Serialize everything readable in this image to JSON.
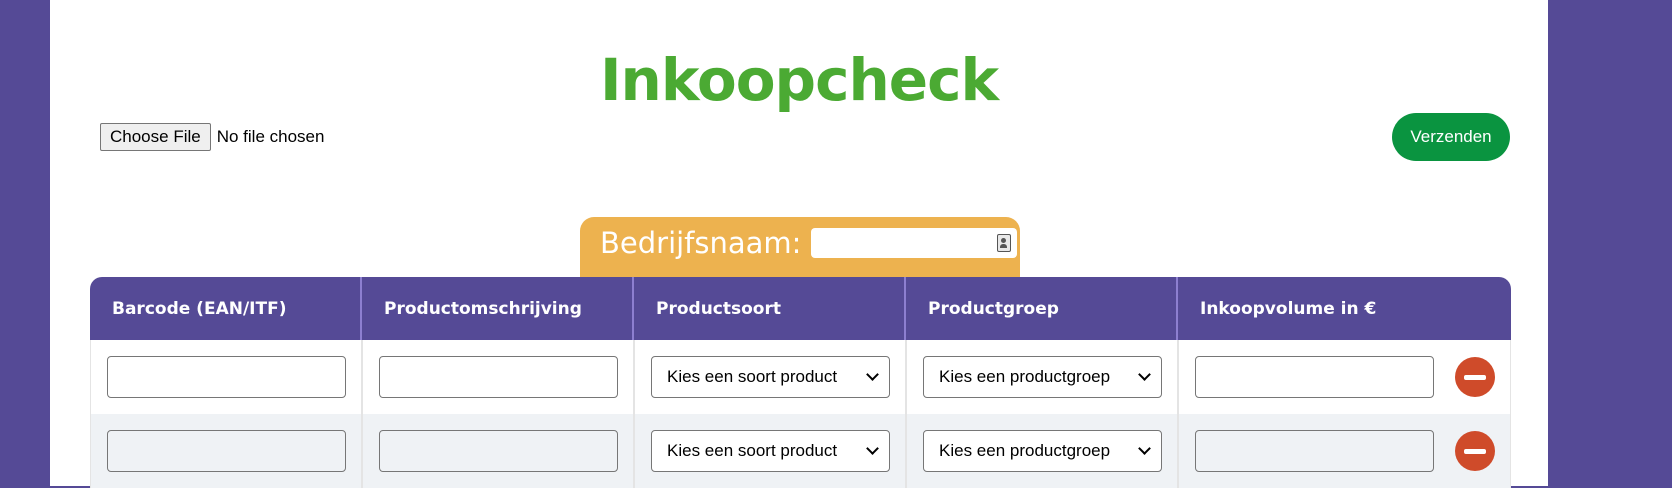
{
  "title": "Inkoopcheck",
  "file_upload": {
    "button_label": "Choose File",
    "status": "No file chosen"
  },
  "submit_label": "Verzenden",
  "company": {
    "label": "Bedrijfsnaam:",
    "value": ""
  },
  "table": {
    "headers": [
      "Barcode (EAN/ITF)",
      "Productomschrijving",
      "Productsoort",
      "Productgroep",
      "Inkoopvolume in €"
    ],
    "rows": [
      {
        "barcode": "",
        "description": "",
        "product_type": "Kies een soort product",
        "product_group": "Kies een productgroep",
        "volume": ""
      },
      {
        "barcode": "",
        "description": "",
        "product_type": "Kies een soort product",
        "product_group": "Kies een productgroep",
        "volume": ""
      }
    ]
  },
  "colors": {
    "background": "#554A96",
    "title": "#4BAA33",
    "submit": "#0A9440",
    "company_tab": "#EDB24F",
    "remove": "#CF4B2A"
  }
}
